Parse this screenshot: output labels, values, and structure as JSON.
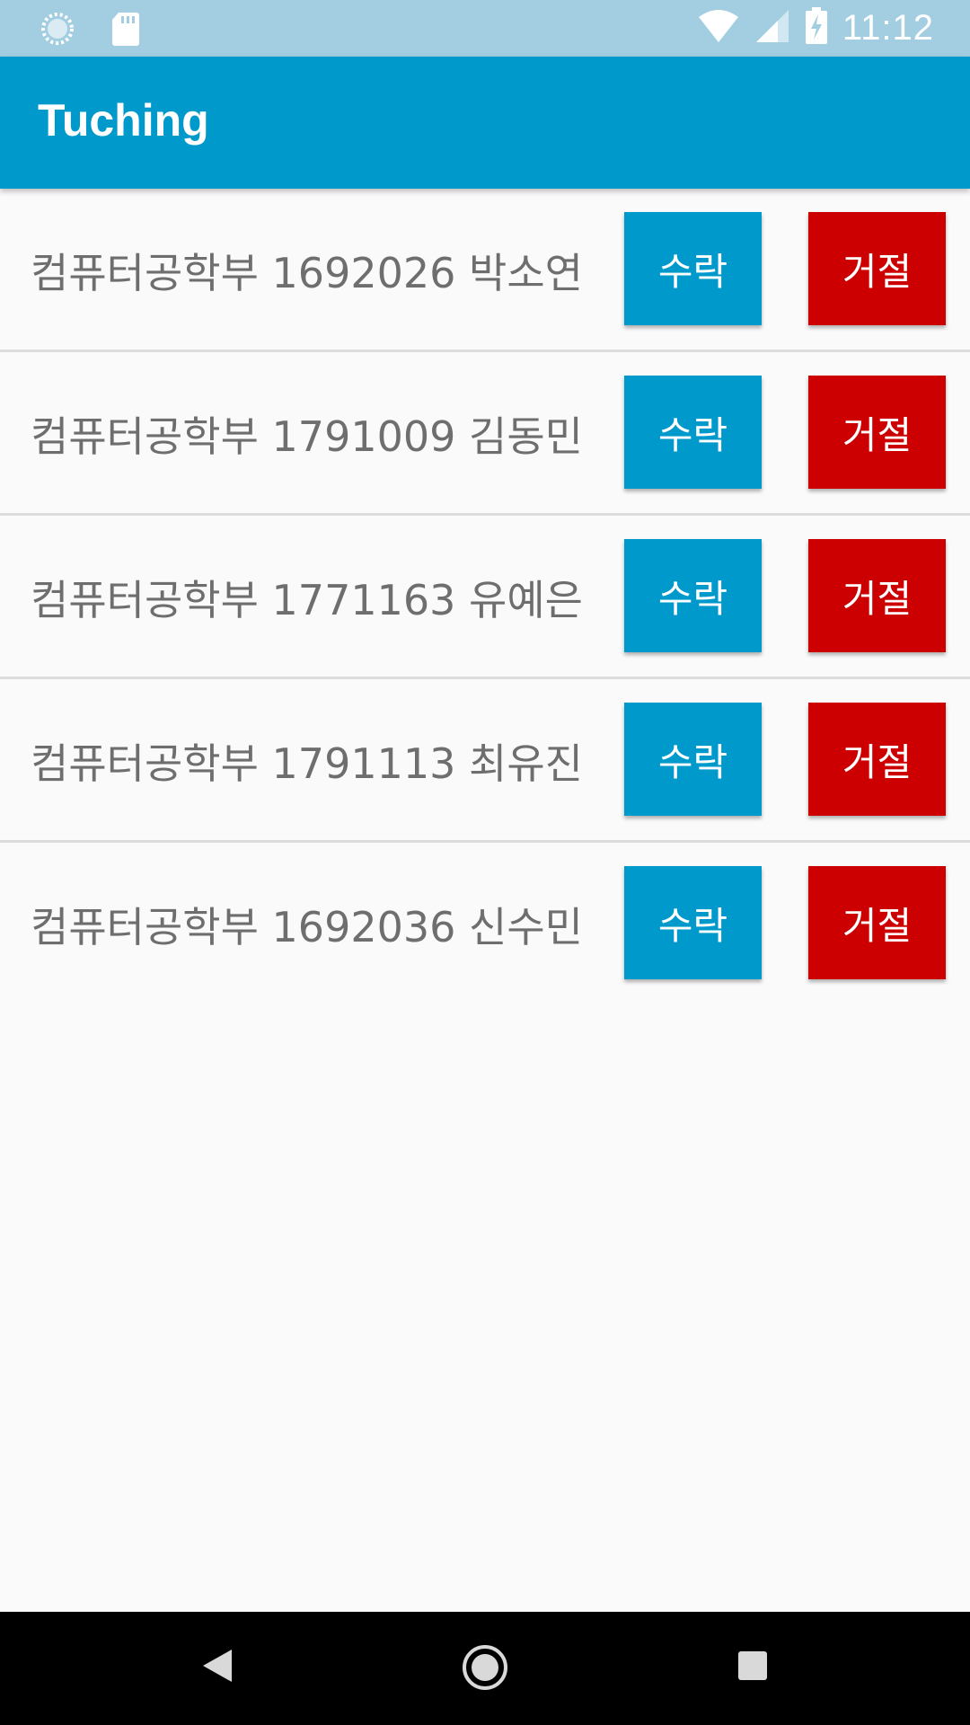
{
  "status_bar": {
    "time": "11:12",
    "left_icons": [
      "loading-circle-icon",
      "sd-card-icon"
    ],
    "right_icons": [
      "wifi-icon",
      "cell-signal-icon",
      "battery-charging-icon"
    ]
  },
  "app_bar": {
    "title": "Tuching",
    "color": "#0099cc"
  },
  "requests": [
    {
      "text": "컴퓨터공학부 1692026 박소연",
      "accept_label": "수락",
      "reject_label": "거절"
    },
    {
      "text": "컴퓨터공학부 1791009 김동민",
      "accept_label": "수락",
      "reject_label": "거절"
    },
    {
      "text": "컴퓨터공학부 1771163 유예은",
      "accept_label": "수락",
      "reject_label": "거절"
    },
    {
      "text": "컴퓨터공학부 1791113 최유진",
      "accept_label": "수락",
      "reject_label": "거절"
    },
    {
      "text": "컴퓨터공학부 1692036 신수민",
      "accept_label": "수락",
      "reject_label": "거절"
    }
  ],
  "colors": {
    "accept": "#0099cc",
    "reject": "#cc0000",
    "status_bar": "#a3cee2"
  },
  "nav_bar": {
    "icons": [
      "back-icon",
      "home-icon",
      "recents-icon"
    ]
  }
}
